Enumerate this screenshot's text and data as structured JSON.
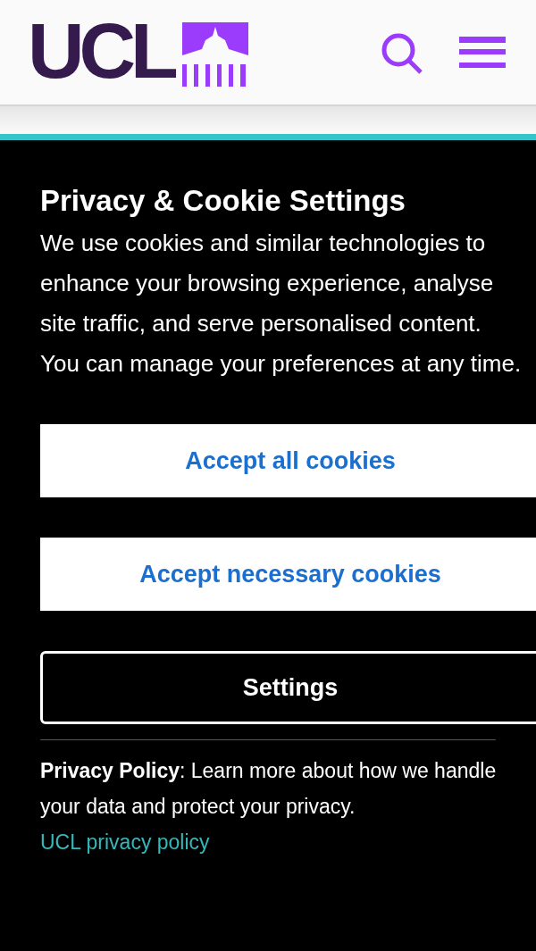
{
  "header": {
    "logo_text": "UCL"
  },
  "banner": {
    "title": "Privacy & Cookie Settings",
    "description": "We use cookies and similar technologies to enhance your browsing experience, analyse site traffic, and serve personalised content. You can manage your preferences at any time.",
    "buttons": [
      {
        "label": "Accept all cookies",
        "kind": "filled"
      },
      {
        "label": "Accept necessary cookies",
        "kind": "filled"
      },
      {
        "label": "Settings",
        "kind": "outline"
      }
    ],
    "policy_text": "**Privacy Policy**: Learn more about how we handle your data and protect your privacy.",
    "policy_link": "UCL privacy policy"
  }
}
